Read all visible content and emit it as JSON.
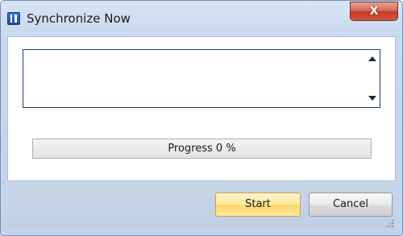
{
  "window": {
    "title": "Synchronize Now",
    "close_label": "X",
    "icon": "app-icon"
  },
  "log": {
    "text": ""
  },
  "progress": {
    "label": "Progress 0 %",
    "value_percent": 0,
    "fill_color": "#06b025"
  },
  "buttons": {
    "start_label": "Start",
    "cancel_label": "Cancel"
  },
  "colors": {
    "title_bar": "#c9d9ee",
    "close_button": "#c33a27",
    "default_button": "#ffe7a2",
    "footer": "#c8d6e9"
  }
}
